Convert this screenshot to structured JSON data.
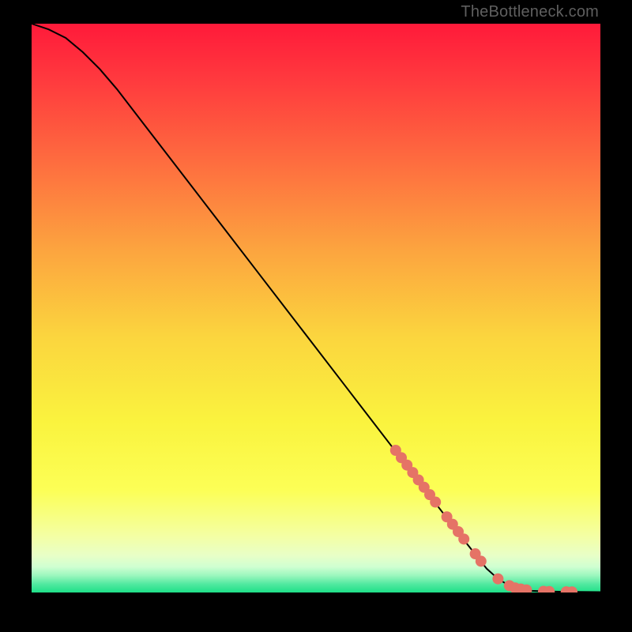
{
  "attribution": "TheBottleneck.com",
  "chart_data": {
    "type": "line",
    "title": "",
    "xlabel": "",
    "ylabel": "",
    "xlim": [
      0,
      100
    ],
    "ylim": [
      0,
      100
    ],
    "curve": {
      "name": "curve",
      "color": "#000000",
      "x": [
        0,
        3,
        6,
        9,
        12,
        15,
        20,
        25,
        30,
        35,
        40,
        45,
        50,
        55,
        60,
        65,
        70,
        75,
        80,
        82,
        84,
        86,
        88,
        90,
        92,
        94,
        96,
        98,
        100
      ],
      "y": [
        100,
        99,
        97.5,
        95,
        92,
        88.5,
        82,
        75.5,
        69,
        62.5,
        56,
        49.5,
        43,
        36.5,
        30,
        23.5,
        17,
        10.5,
        4.2,
        2.4,
        1.2,
        0.6,
        0.3,
        0.2,
        0.15,
        0.12,
        0.1,
        0.08,
        0.07
      ]
    },
    "markers": {
      "name": "highlight-points",
      "color": "#E57366",
      "radius": 7,
      "points": [
        {
          "x": 64,
          "y": 25
        },
        {
          "x": 65,
          "y": 23.7
        },
        {
          "x": 66,
          "y": 22.4
        },
        {
          "x": 67,
          "y": 21.1
        },
        {
          "x": 68,
          "y": 19.8
        },
        {
          "x": 69,
          "y": 18.5
        },
        {
          "x": 70,
          "y": 17.2
        },
        {
          "x": 71,
          "y": 15.9
        },
        {
          "x": 73,
          "y": 13.3
        },
        {
          "x": 74,
          "y": 12
        },
        {
          "x": 75,
          "y": 10.7
        },
        {
          "x": 76,
          "y": 9.4
        },
        {
          "x": 78,
          "y": 6.8
        },
        {
          "x": 79,
          "y": 5.5
        },
        {
          "x": 82,
          "y": 2.4
        },
        {
          "x": 84,
          "y": 1.2
        },
        {
          "x": 85,
          "y": 0.8
        },
        {
          "x": 86,
          "y": 0.6
        },
        {
          "x": 87,
          "y": 0.45
        },
        {
          "x": 90,
          "y": 0.2
        },
        {
          "x": 91,
          "y": 0.18
        },
        {
          "x": 94,
          "y": 0.12
        },
        {
          "x": 95,
          "y": 0.11
        }
      ]
    },
    "background_gradient": {
      "stops": [
        {
          "offset": 0.0,
          "color": "#FF1A3A"
        },
        {
          "offset": 0.1,
          "color": "#FF3A3E"
        },
        {
          "offset": 0.25,
          "color": "#FE6F3F"
        },
        {
          "offset": 0.4,
          "color": "#FCA53F"
        },
        {
          "offset": 0.55,
          "color": "#FBD53E"
        },
        {
          "offset": 0.7,
          "color": "#FAF33E"
        },
        {
          "offset": 0.82,
          "color": "#FCFF56"
        },
        {
          "offset": 0.9,
          "color": "#F4FFA3"
        },
        {
          "offset": 0.935,
          "color": "#E8FFC7"
        },
        {
          "offset": 0.955,
          "color": "#CFFFD1"
        },
        {
          "offset": 0.97,
          "color": "#9CF7BE"
        },
        {
          "offset": 0.985,
          "color": "#52E9A0"
        },
        {
          "offset": 1.0,
          "color": "#1FE088"
        }
      ]
    }
  }
}
